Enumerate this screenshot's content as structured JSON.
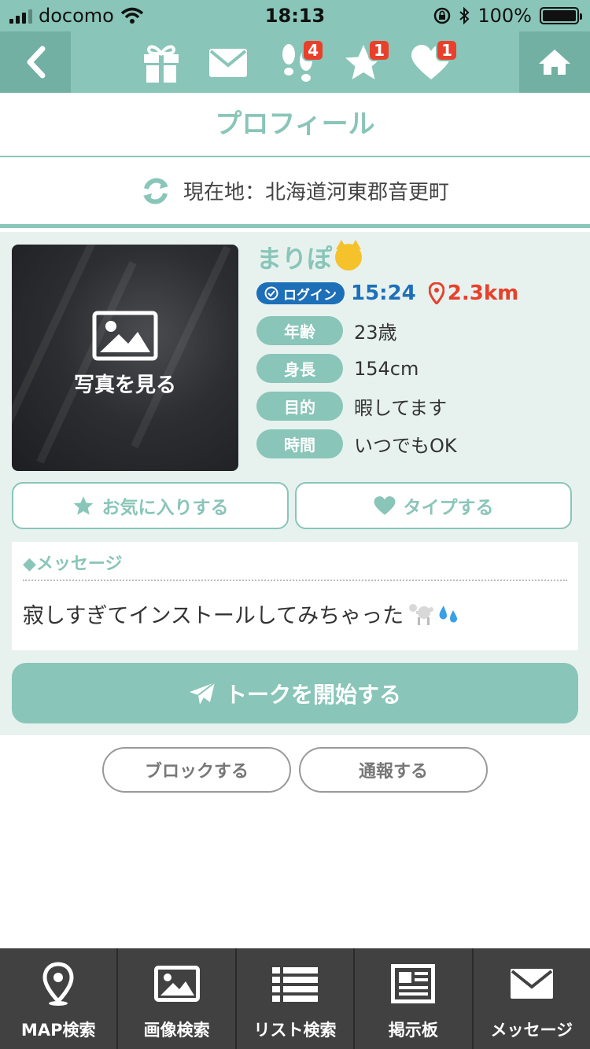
{
  "status_bar": {
    "carrier": "docomo",
    "time": "18:13",
    "battery": "100%"
  },
  "nav": {
    "icons": [
      {
        "name": "gift-icon",
        "badge": ""
      },
      {
        "name": "mail-icon",
        "badge": ""
      },
      {
        "name": "footprint-icon",
        "badge": "4"
      },
      {
        "name": "star-icon",
        "badge": "1"
      },
      {
        "name": "heart-icon",
        "badge": "1"
      }
    ]
  },
  "page": {
    "title": "プロフィール",
    "location": "現在地：北海道河東郡音更町"
  },
  "profile": {
    "photo_label": "写真を見る",
    "name": "まりぽ",
    "login_label": "ログイン",
    "login_time": "15:24",
    "distance": "2.3km",
    "attributes": [
      {
        "label": "年齢",
        "value": "23歳"
      },
      {
        "label": "身長",
        "value": "154cm"
      },
      {
        "label": "目的",
        "value": "暇してます"
      },
      {
        "label": "時間",
        "value": "いつでもOK"
      }
    ],
    "favorite_label": "お気に入りする",
    "type_label": "タイプする",
    "message_heading": "◆メッセージ",
    "message_text": "寂しすぎてインストールしてみちゃった",
    "talk_label": "トークを開始する"
  },
  "moderation": {
    "block_label": "ブロックする",
    "report_label": "通報する"
  },
  "tabbar": {
    "tabs": [
      {
        "label": "MAP検索",
        "icon": "map-pin-icon"
      },
      {
        "label": "画像検索",
        "icon": "image-icon"
      },
      {
        "label": "リスト検索",
        "icon": "list-icon"
      },
      {
        "label": "掲示板",
        "icon": "newspaper-icon"
      },
      {
        "label": "メッセージ",
        "icon": "envelope-icon"
      }
    ]
  },
  "colors": {
    "accent": "#89c5b8",
    "login_blue": "#1d6fb8",
    "distance_red": "#e8402a",
    "tabbar": "#414141"
  }
}
